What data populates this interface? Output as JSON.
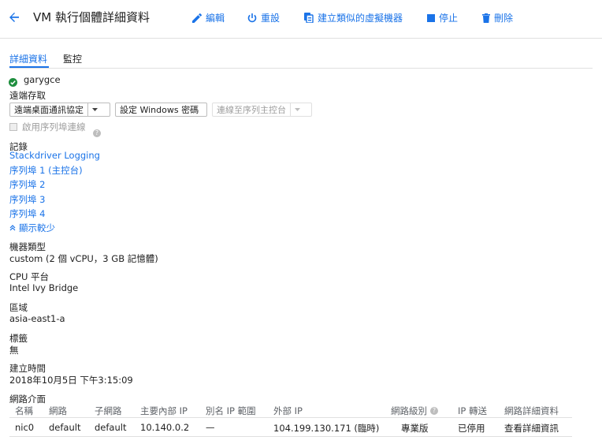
{
  "header": {
    "title": "VM 執行個體詳細資料",
    "actions": {
      "edit": "編輯",
      "reset": "重設",
      "create_similar": "建立類似的虛擬機器",
      "stop": "停止",
      "delete": "刪除"
    }
  },
  "tabs": [
    {
      "label": "詳細資料",
      "active": true
    },
    {
      "label": "監控",
      "active": false
    }
  ],
  "instance": {
    "name": "garygce",
    "status": "running"
  },
  "remote_access": {
    "heading": "遠端存取",
    "rdp_button": "遠端桌面通訊協定",
    "windows_password_button": "設定 Windows 密碼",
    "serial_console_button": "連線至序列主控台",
    "enable_serial_label": "啟用序列埠連線"
  },
  "logs": {
    "heading": "記錄",
    "links": [
      "Stackdriver Logging",
      "序列埠 1 (主控台)",
      "序列埠 2",
      "序列埠 3",
      "序列埠 4"
    ],
    "show_less": "顯示較少"
  },
  "details": {
    "machine_type_label": "機器類型",
    "machine_type_value": "custom (2 個 vCPU，3 GB 記憶體)",
    "cpu_label": "CPU 平台",
    "cpu_value": "Intel Ivy Bridge",
    "zone_label": "區域",
    "zone_value": "asia-east1-a",
    "labels_label": "標籤",
    "labels_value": "無",
    "created_label": "建立時間",
    "created_value": "2018年10月5日 下午3:15:09"
  },
  "network": {
    "heading": "網路介面",
    "columns": [
      "名稱",
      "網路",
      "子網路",
      "主要內部 IP",
      "別名 IP 範圍",
      "外部 IP",
      "網路級別",
      "IP 轉送",
      "網路詳細資料"
    ],
    "row": [
      "nic0",
      "default",
      "default",
      "10.140.0.2",
      "—",
      "104.199.130.171 (臨時)",
      "專業版",
      "已停用",
      "查看詳細資訊"
    ]
  },
  "colors": {
    "accent": "#1a73e8",
    "success": "#1e8e3e"
  }
}
